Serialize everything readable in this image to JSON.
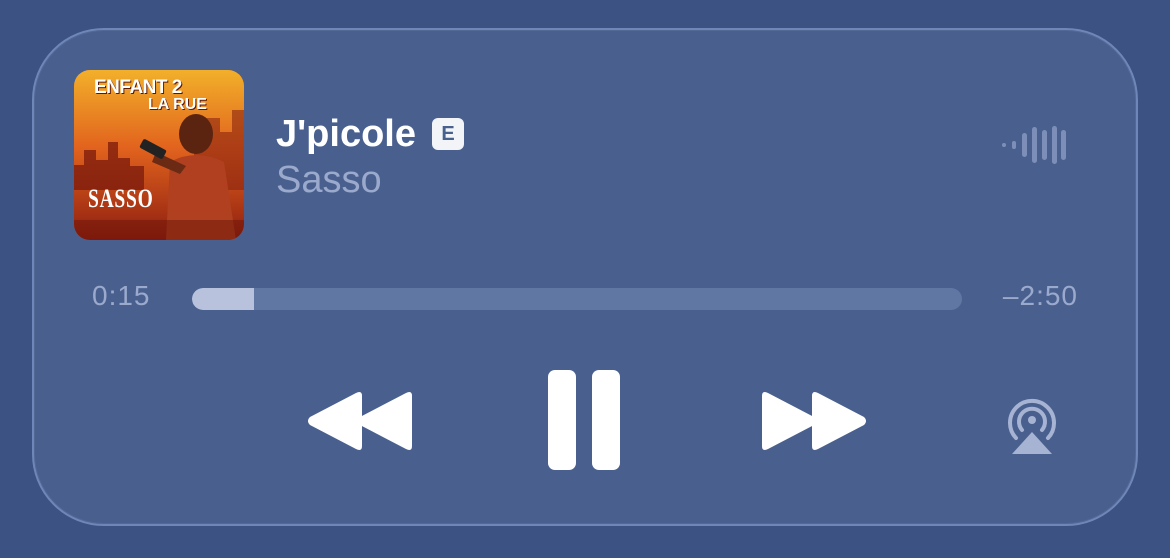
{
  "now_playing": {
    "artwork": {
      "title_line1": "ENFANT 2",
      "title_line2": "LA RUE",
      "artist_text": "SASSO"
    },
    "track_title": "J'picole",
    "explicit_badge": "E",
    "artist": "Sasso"
  },
  "playback": {
    "elapsed": "0:15",
    "remaining": "–2:50",
    "progress_fraction": 0.081
  },
  "controls": {
    "rewind": "rewind-icon",
    "pause": "pause-icon",
    "forward": "fast-forward-icon",
    "airplay": "airplay-icon",
    "waveform": "audio-waveform-icon"
  },
  "colors": {
    "background": "#3b5282",
    "card": "#49608f",
    "card_border": "#6e86b8",
    "primary_text": "#ffffff",
    "secondary_text": "#9aa9cc",
    "progress_track": "#6076a3",
    "progress_fill": "#b8c2dd"
  }
}
